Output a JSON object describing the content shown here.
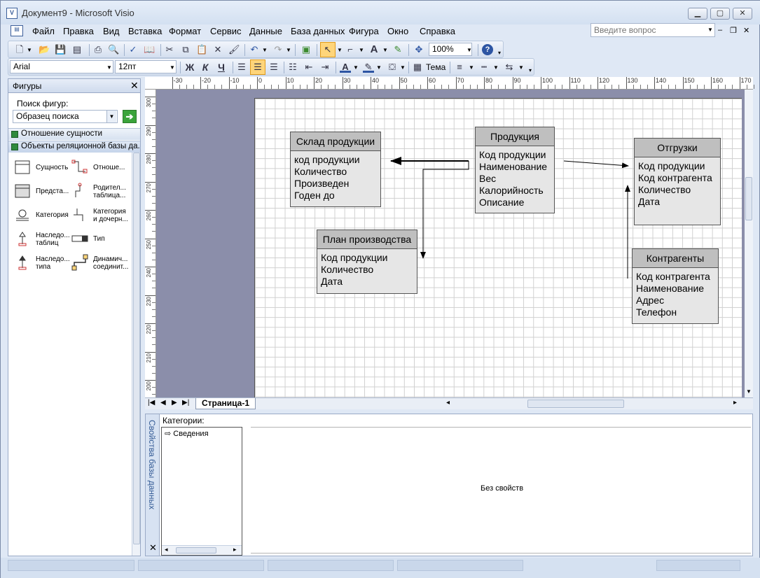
{
  "window": {
    "title": "Документ9 - Microsoft Visio",
    "icon": "visio-app-icon"
  },
  "menu": [
    "Файл",
    "Правка",
    "Вид",
    "Вставка",
    "Формат",
    "Сервис",
    "Данные",
    "База данных",
    "Фигура",
    "Окно",
    "Справка"
  ],
  "question_box": {
    "placeholder": "Введите вопрос"
  },
  "toolbar": {
    "zoom": "100%"
  },
  "format_toolbar": {
    "font": "Arial",
    "size": "12пт",
    "bold": "Ж",
    "italic": "К",
    "underline": "Ч",
    "theme": "Тема"
  },
  "shapes_panel": {
    "title": "Фигуры",
    "search_label": "Поиск фигур:",
    "search_placeholder": "Образец поиска",
    "stencils": [
      "Отношение сущности",
      "Объекты реляционной базы да..."
    ],
    "shapes": [
      {
        "label": "Сущность",
        "icon": "entity-shape-icon"
      },
      {
        "label": "Отноше...",
        "icon": "relationship-shape-icon"
      },
      {
        "label": "Предста...",
        "icon": "view-shape-icon"
      },
      {
        "label": "Родител...\nтаблица...",
        "icon": "parent-table-shape-icon"
      },
      {
        "label": "Категория",
        "icon": "category-shape-icon"
      },
      {
        "label": "Категория\nи дочерн...",
        "icon": "category-child-shape-icon"
      },
      {
        "label": "Наследо...\nтаблиц",
        "icon": "table-inheritance-shape-icon"
      },
      {
        "label": "Тип",
        "icon": "type-shape-icon"
      },
      {
        "label": "Наследо...\nтипа",
        "icon": "type-inheritance-shape-icon"
      },
      {
        "label": "Динамич...\nсоединит...",
        "icon": "dynamic-connector-shape-icon"
      }
    ]
  },
  "rulers": {
    "top": [
      "-30",
      "-20",
      "-10",
      "0",
      "10",
      "20",
      "30",
      "40",
      "50",
      "60",
      "70",
      "80",
      "90",
      "100",
      "110",
      "120",
      "130",
      "140",
      "150",
      "160",
      "170"
    ],
    "left": [
      "300",
      "290",
      "280",
      "270",
      "260",
      "250",
      "240",
      "230",
      "220",
      "210",
      "200"
    ]
  },
  "diagram": {
    "entities": [
      {
        "name": "Склад продукции",
        "fields": [
          "код продукции",
          "Количество",
          "Произведен",
          "Годен до"
        ]
      },
      {
        "name": "Продукция",
        "fields": [
          "Код продукции",
          "Наименование",
          "Вес",
          "Калорийность",
          "Описание"
        ]
      },
      {
        "name": "Отгрузки",
        "fields": [
          "Код продукции",
          "Код контрагента",
          "Количество",
          "Дата"
        ]
      },
      {
        "name": "План производства",
        "fields": [
          "Код продукции",
          "Количество",
          "Дата"
        ]
      },
      {
        "name": "Контрагенты",
        "fields": [
          "Код контрагента",
          "Наименование",
          "Адрес",
          "Телефон"
        ]
      }
    ]
  },
  "page_tab": "Страница-1",
  "db_properties": {
    "vertical_title": "Свойства базы данных",
    "categories_label": "Категории:",
    "category_item": "Сведения",
    "no_properties": "Без свойств"
  }
}
